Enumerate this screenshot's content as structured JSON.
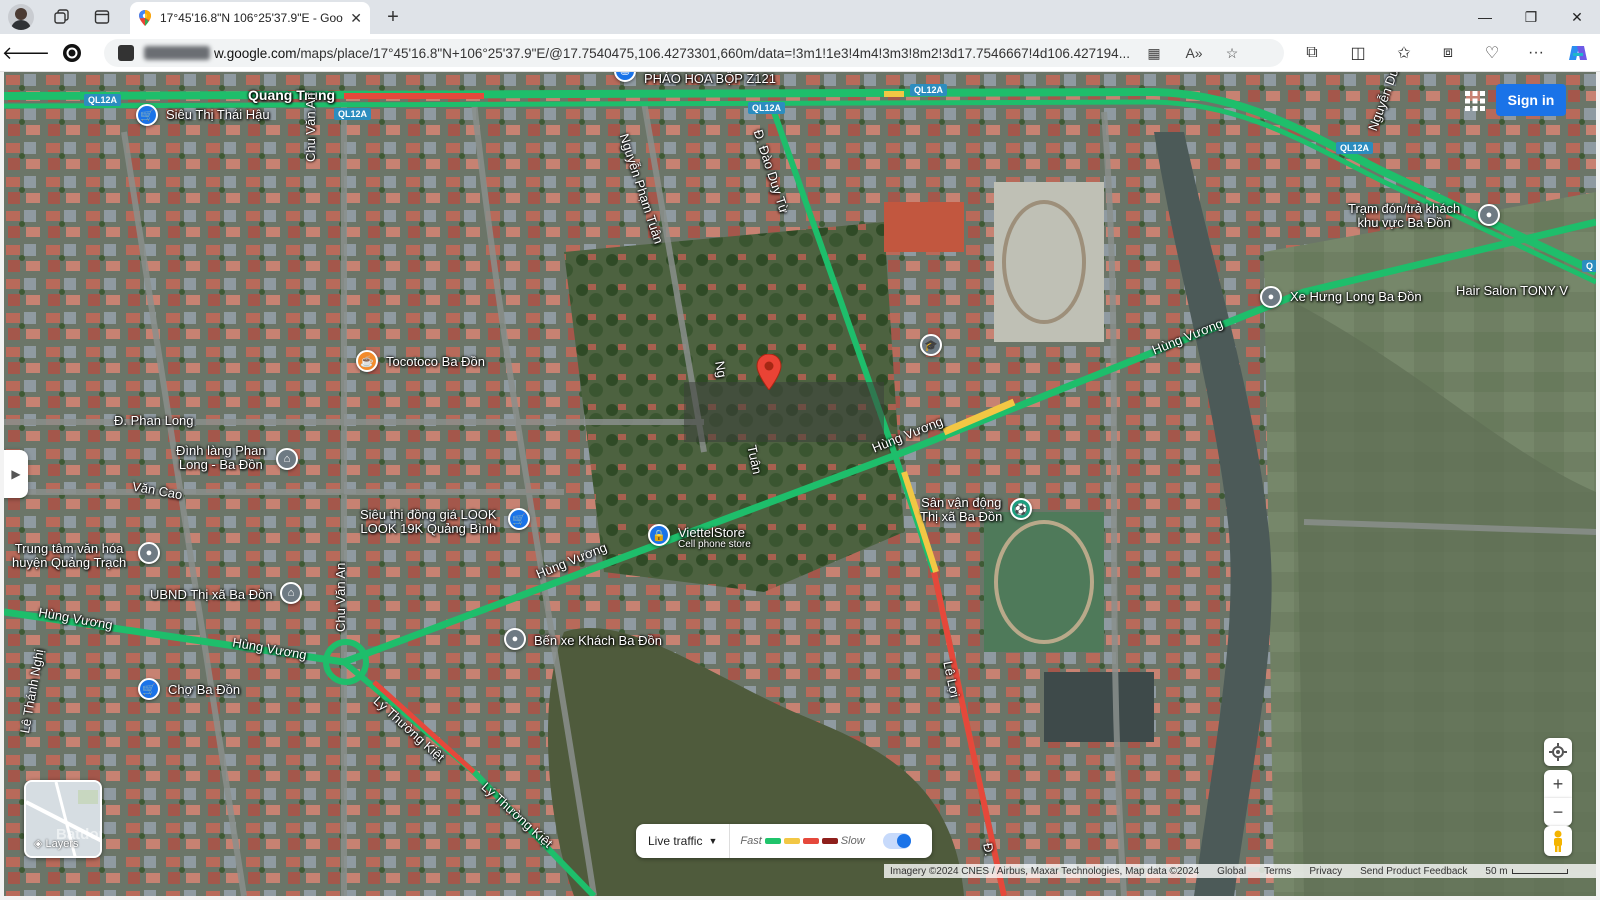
{
  "browser": {
    "tab_title": "17°45'16.8\"N 106°25'37.9\"E - Goo",
    "url_host": "w.google.com",
    "url_path": "/maps/place/17°45'16.8\"N+106°25'37.9\"E/@17.7540475,106.4273301,660m/data=!3m1!1e3!4m4!3m3!8m2!3d17.7546667!4d106.427194..."
  },
  "map": {
    "sign_in": "Sign in",
    "road_labels": {
      "quang_trung": "Quang Trung",
      "chu_van_an_top": "Chu Văn An",
      "chu_van_an_bottom": "Chu Văn An",
      "nguyen_pham_tuan": "Nguyễn Phạm Tuân",
      "dao_duy_tu": "Đ. Đào Duy Từ",
      "hung_vuong_right": "Hùng Vương",
      "hung_vuong_center": "Hùng Vương",
      "hung_vuong_mid": "Hùng Vương",
      "hung_vuong_left1": "Hùng Vương",
      "hung_vuong_left2": "Hùng Vương",
      "phan_long": "Đ. Phan Long",
      "van_cao": "Văn Cao",
      "le_loi": "Lê Lợi",
      "ly_thuong_kiet_1": "Lý Thường Kiệt",
      "ly_thuong_kiet_2": "Lý Thường Kiệt",
      "le_thanh_nghi": "Lê Thánh Nghị",
      "nguyen_du": "Nguyễn Du",
      "d_bottom": "Đ.",
      "ng_fragment": "Ng",
      "tuan_fragment": "Tuân"
    },
    "shields": [
      "QL12A",
      "QL12A",
      "QL12A",
      "QL12A",
      "QL12A",
      "Q"
    ],
    "places": {
      "phao_hoa": "PHÁO HOA BỘP Z121",
      "sieu_thi_thai_hau": "Siêu Thị Thái Hậu",
      "tocotoco": "Tocotoco Ba Đồn",
      "dinh_lang_1": "Đình làng Phan",
      "dinh_lang_2": "Long - Ba Đồn",
      "look_1": "Siêu thị đồng giá LOOK",
      "look_2": "LOOK 19K Quảng Bình",
      "trung_tam_1": "Trung tâm văn hóa",
      "trung_tam_2": "huyện Quảng Trạch",
      "ubnd": "UBND Thị xã Ba Đồn",
      "ben_xe": "Bến xe Khách Ba Đồn",
      "cho": "Chợ Ba Đồn",
      "viettel": "ViettelStore",
      "viettel_sub": "Cell phone store",
      "san_van_dong_1": "Sân vận động",
      "san_van_dong_2": "Thị xã Ba Đồn",
      "tram_don_1": "Trạm đón/trả khách",
      "tram_don_2": "khu vực Ba Đồn",
      "xe_hung_long": "Xe Hưng Long Ba Đồn",
      "hair_salon": "Hair Salon TONY V"
    },
    "layers_label": "Layers",
    "watermark": "Batdongsan",
    "traffic": {
      "live": "Live traffic",
      "fast": "Fast",
      "slow": "Slow",
      "colors": [
        "#1fc46b",
        "#f2c744",
        "#e5483b",
        "#8e1f1b"
      ]
    },
    "footer": {
      "imagery": "Imagery ©2024 CNES / Airbus, Maxar Technologies, Map data ©2024",
      "global": "Global",
      "terms": "Terms",
      "privacy": "Privacy",
      "feedback": "Send Product Feedback",
      "scale": "50 m"
    }
  }
}
